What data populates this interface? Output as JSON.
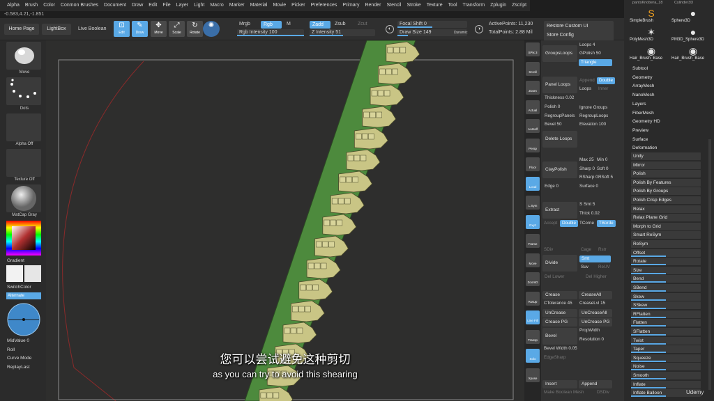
{
  "menu": [
    "Alpha",
    "Brush",
    "Color",
    "Conmon Brushes",
    "Document",
    "Draw",
    "Edit",
    "File",
    "Layer",
    "Light",
    "Macro",
    "Marker",
    "Material",
    "Movie",
    "Picker",
    "Preferences",
    "Primary",
    "Render",
    "Stencil",
    "Stroke",
    "Texture",
    "Tool",
    "Transform",
    "Zplugin",
    "Zscript"
  ],
  "coords": "-0.583,4.21,-1.851",
  "shelf": {
    "home_page": "Home Page",
    "lightbox": "LightBox",
    "live_boolean": "Live Boolean",
    "tools": [
      {
        "label": "Edit",
        "glyph": "⊡",
        "active": true
      },
      {
        "label": "Draw",
        "glyph": "✎",
        "active": true
      },
      {
        "label": "Move",
        "glyph": "✥",
        "active": false
      },
      {
        "label": "Scale",
        "glyph": "⤢",
        "active": false
      },
      {
        "label": "Rotate",
        "glyph": "↻",
        "active": false
      }
    ],
    "mrgb": "Mrgb",
    "rgb": "Rgb",
    "m": "M",
    "zadd": "Zadd",
    "zsub": "Zsub",
    "zcut": "Zcut",
    "rgb_intensity": "Rgb Intensity 100",
    "z_intensity": "Z Intensity 51",
    "focal_shift": "Focal Shift 0",
    "draw_size": "Draw Size 149",
    "dynamic": "Dynamic",
    "active_points": "ActivePoints: 11,230",
    "total_points": "TotalPoints: 2.88 Mil",
    "restore_custom_ui": "Restore Custom UI",
    "store_config": "Store Config"
  },
  "left": {
    "move": "Move",
    "dots": "Dots",
    "alpha_off": "Alpha Off",
    "texture_off": "Texture Off",
    "matcap": "MatCap Gray",
    "gradient": "Gradient",
    "switch_color": "SwitchColor",
    "alternate": "Alternate",
    "mid_value": "MidValue 0",
    "roll": "Roll",
    "curve_mode": "Curve Mode",
    "replay_last": "ReplayLast"
  },
  "midcol": [
    "SPix 3",
    "Scroll",
    "Zoom",
    "Actual",
    "AAHalf",
    "Persp",
    "Floor",
    "Local",
    "L.Sym",
    "Gxyz",
    "Frame",
    "Move",
    "ZoomD",
    "RotUp",
    "Line Fill",
    "Transp",
    "Solo",
    "Xpose"
  ],
  "geo": {
    "groups_loops": "GroupsLoops",
    "loops": "Loops 4",
    "gpolish": "GPolish 50",
    "triangle": "Triangle",
    "panel_loops": "Panel Loops",
    "append": "Append",
    "double": "Double",
    "thickness": "Thickness 0.02",
    "loops2": "Loops",
    "inner": "Inner",
    "polish": "Polish 0",
    "ignore_groups": "Ignore Groups",
    "regroup_panels": "RegroupPanels",
    "regroup_loops": "RegroupLoops",
    "bevel": "Bevel 50",
    "elevation": "Elevation 100",
    "delete_loops": "Delete Loops",
    "clay_polish": "ClayPolish",
    "max": "Max 25",
    "min": "Min 0",
    "sharp": "Sharp 0",
    "soft": "Soft 0",
    "rsharp": "RSharp 0",
    "rsoft": "RSoft 5",
    "edge": "Edge 0",
    "surface": "Surface 0",
    "extract": "Extract",
    "s_smt": "S Smt 5",
    "thick": "Thick 0.02",
    "accept": "Accept",
    "double2": "Double",
    "tcorne": "TCorne",
    "tborde": "TBorde",
    "sdiv": "SDiv",
    "cage": "Cage",
    "rstr": "Rstr",
    "divide": "Divide",
    "smt": "Smt",
    "suv": "Suv",
    "reuv": "ReUV",
    "del_lower": "Del Lower",
    "del_higher": "Del Higher",
    "crease": "Crease",
    "crease_all": "CreaseAll",
    "ctolerance": "CTolerance 45",
    "crease_lvl": "CreaseLvl 15",
    "uncrease": "UnCrease",
    "uncrease_all": "UnCreaseAll",
    "crease_pg": "Crease PG",
    "uncrease_pg": "UnCrease PG",
    "bevel2": "Bevel",
    "prop_width": "PropWidth",
    "resolution": "Resolution 0",
    "bevel_width": "Bevel Width 0.05",
    "edge_sharp": "EdgeSharp",
    "insert": "Insert",
    "append2": "Append",
    "make_boolean": "Make Boolean Mesh",
    "dsdiv": "DSDiv"
  },
  "right": {
    "thumbs": [
      "SimpleBrush",
      "Sphere3D",
      "PolyMesh3D",
      "PM3D_Sphere3D",
      "Hair_Brush_Base",
      "Hair_Brush_Base"
    ],
    "thumbs_top": [
      "pantsKnobera_18",
      "Cylinder3D"
    ],
    "menu_items": [
      "Subtool",
      "Geometry",
      "ArrayMesh",
      "NanoMesh",
      "Layers",
      "FiberMesh",
      "Geometry HD",
      "Preview",
      "Surface",
      "Deformation"
    ],
    "deform_items": [
      {
        "label": "Unify",
        "v": 0
      },
      {
        "label": "Mirror",
        "v": 0
      },
      {
        "label": "Polish",
        "v": 0
      },
      {
        "label": "Polish By Features",
        "v": 0
      },
      {
        "label": "Polish By Groups",
        "v": 0
      },
      {
        "label": "Polish Crisp Edges",
        "v": 0
      },
      {
        "label": "Relax",
        "v": 0
      },
      {
        "label": "Relax Plane Grid",
        "v": 0
      },
      {
        "label": "Morph to Grid",
        "v": 0
      },
      {
        "label": "Smart ReSym",
        "v": 0
      },
      {
        "label": "ReSym",
        "v": 0
      },
      {
        "label": "Offset",
        "v": 0.5
      },
      {
        "label": "Rotate",
        "v": 0.5
      },
      {
        "label": "Size",
        "v": 0.5
      },
      {
        "label": "Bend",
        "v": 0.5
      },
      {
        "label": "SBend",
        "v": 0.5
      },
      {
        "label": "Skew",
        "v": 0.5
      },
      {
        "label": "SSkew",
        "v": 0.5
      },
      {
        "label": "RFlatten",
        "v": 0.5
      },
      {
        "label": "Flatten",
        "v": 0.5
      },
      {
        "label": "SFlatten",
        "v": 0.5
      },
      {
        "label": "Twist",
        "v": 0.5
      },
      {
        "label": "Taper",
        "v": 0.5
      },
      {
        "label": "Squeeze",
        "v": 0.5
      },
      {
        "label": "Noise",
        "v": 0.5
      },
      {
        "label": "Smooth",
        "v": 0.5
      },
      {
        "label": "Inflate",
        "v": 0.5
      },
      {
        "label": "Inflate Balloon",
        "v": 0.5
      }
    ]
  },
  "subtitle": {
    "zh": "您可以尝试避免这种剪切",
    "en": "as you can try to avoid this shearing"
  },
  "watermark": "Udemy"
}
